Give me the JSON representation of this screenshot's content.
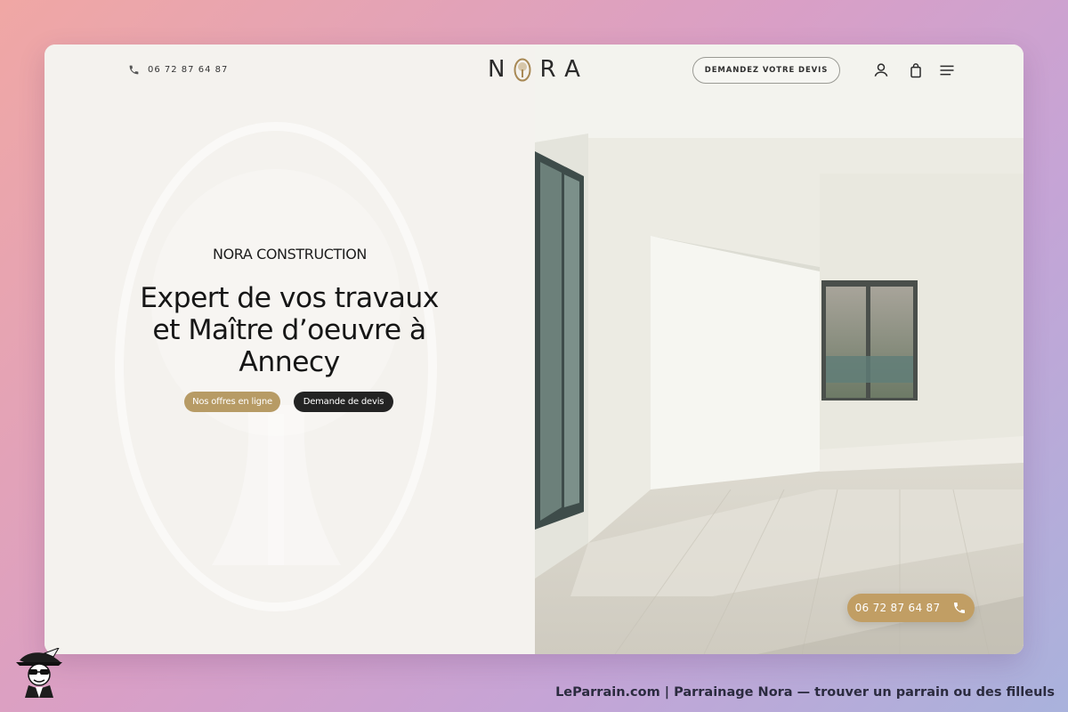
{
  "header": {
    "phone": "06 72 87 64 87",
    "logo_text": "NORA",
    "quote_button_label": "DEMANDEZ VOTRE DEVIS",
    "icons": [
      "phone-icon",
      "account-icon",
      "shopping-bag-icon",
      "menu-icon"
    ]
  },
  "hero": {
    "eyebrow": "NORA CONSTRUCTION",
    "headline_line1": "Expert de vos travaux",
    "headline_line2": "et Maître d’oeuvre à",
    "headline_line3": "Annecy",
    "primary_button": "Nos offres en ligne",
    "secondary_button": "Demande de devis"
  },
  "floating_phone": {
    "label": "06 72 87 64 87"
  },
  "footer": {
    "caption": "LeParrain.com | Parrainage Nora — trouver un parrain ou des filleuls"
  },
  "colors": {
    "gold": "#b79b65",
    "dark": "#232323",
    "panel": "#f4f2ee"
  }
}
